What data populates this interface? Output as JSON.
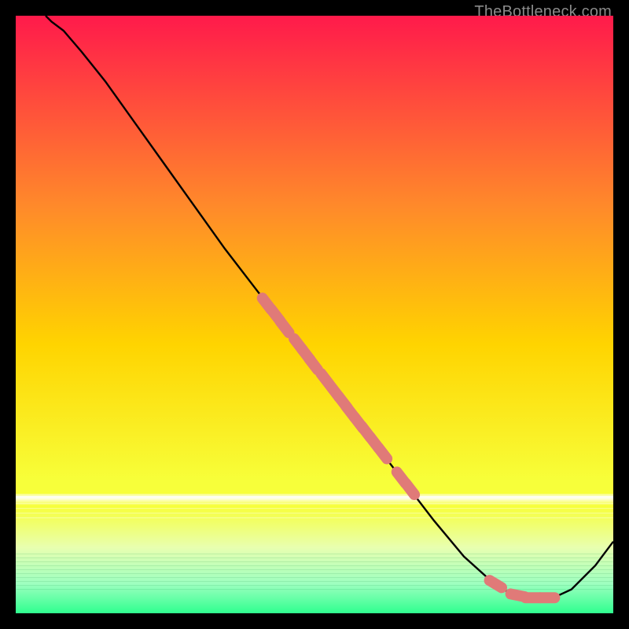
{
  "attribution": "TheBottleneck.com",
  "chart_data": {
    "type": "line",
    "title": "",
    "xlabel": "",
    "ylabel": "",
    "xlim": [
      0,
      100
    ],
    "ylim": [
      0,
      100
    ],
    "gradient_top_color": "#ff1a4b",
    "gradient_mid_upper_color": "#ff8a2a",
    "gradient_mid_color": "#ffd400",
    "gradient_mid_lower_color": "#f7ff3a",
    "gradient_band_color": "#e8ffb0",
    "gradient_bottom_color": "#2fff8f",
    "line_color": "#000000",
    "marker_color": "#e07a78",
    "curve": [
      {
        "x": 5,
        "y": 100
      },
      {
        "x": 6,
        "y": 99
      },
      {
        "x": 8,
        "y": 97.5
      },
      {
        "x": 11,
        "y": 94
      },
      {
        "x": 15,
        "y": 89
      },
      {
        "x": 20,
        "y": 82
      },
      {
        "x": 25,
        "y": 75
      },
      {
        "x": 30,
        "y": 68
      },
      {
        "x": 35,
        "y": 61
      },
      {
        "x": 40,
        "y": 54.5
      },
      {
        "x": 45,
        "y": 48
      },
      {
        "x": 50,
        "y": 41.5
      },
      {
        "x": 55,
        "y": 35
      },
      {
        "x": 60,
        "y": 28.5
      },
      {
        "x": 65,
        "y": 22
      },
      {
        "x": 70,
        "y": 15.5
      },
      {
        "x": 75,
        "y": 9.5
      },
      {
        "x": 80,
        "y": 5
      },
      {
        "x": 83,
        "y": 3.2
      },
      {
        "x": 86,
        "y": 2.6
      },
      {
        "x": 90,
        "y": 2.6
      },
      {
        "x": 93,
        "y": 4
      },
      {
        "x": 97,
        "y": 8
      },
      {
        "x": 100,
        "y": 12
      }
    ],
    "markers": [
      {
        "x": 42,
        "y": 51.8
      },
      {
        "x": 43.5,
        "y": 49.9
      },
      {
        "x": 45,
        "y": 47.9
      },
      {
        "x": 47.3,
        "y": 45.0
      },
      {
        "x": 48.6,
        "y": 43.3
      },
      {
        "x": 49.8,
        "y": 41.7
      },
      {
        "x": 51.8,
        "y": 39.2
      },
      {
        "x": 53.4,
        "y": 37.1
      },
      {
        "x": 54.8,
        "y": 35.3
      },
      {
        "x": 56.0,
        "y": 33.7
      },
      {
        "x": 57.4,
        "y": 31.9
      },
      {
        "x": 58.6,
        "y": 30.4
      },
      {
        "x": 60.0,
        "y": 28.6
      },
      {
        "x": 61.4,
        "y": 26.8
      },
      {
        "x": 64.5,
        "y": 22.7
      },
      {
        "x": 66.0,
        "y": 20.8
      },
      {
        "x": 80.3,
        "y": 4.9
      },
      {
        "x": 84.0,
        "y": 3.0
      },
      {
        "x": 86.5,
        "y": 2.6
      },
      {
        "x": 89.0,
        "y": 2.6
      }
    ]
  }
}
